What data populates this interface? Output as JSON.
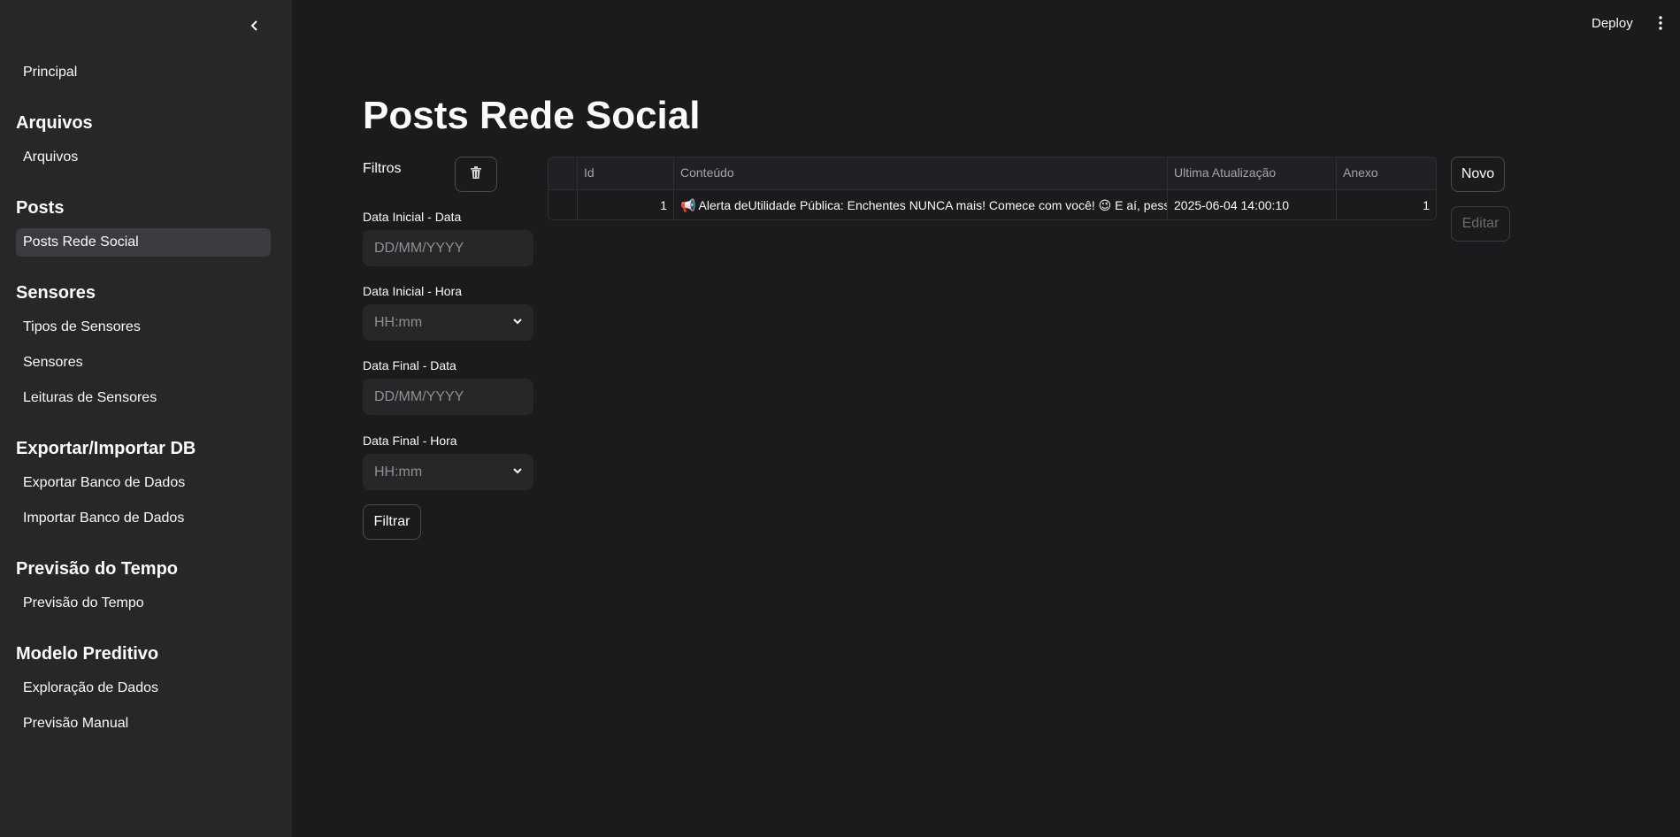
{
  "sidebar": {
    "collapse_icon": "chevron-left-icon",
    "items": [
      {
        "type": "link",
        "label": "Principal"
      },
      {
        "type": "section",
        "label": "Arquivos"
      },
      {
        "type": "link",
        "label": "Arquivos"
      },
      {
        "type": "section",
        "label": "Posts"
      },
      {
        "type": "link",
        "label": "Posts Rede Social",
        "active": true
      },
      {
        "type": "section",
        "label": "Sensores"
      },
      {
        "type": "link",
        "label": "Tipos de Sensores"
      },
      {
        "type": "link",
        "label": "Sensores"
      },
      {
        "type": "link",
        "label": "Leituras de Sensores"
      },
      {
        "type": "section",
        "label": "Exportar/Importar DB"
      },
      {
        "type": "link",
        "label": "Exportar Banco de Dados"
      },
      {
        "type": "link",
        "label": "Importar Banco de Dados"
      },
      {
        "type": "section",
        "label": "Previsão do Tempo"
      },
      {
        "type": "link",
        "label": "Previsão do Tempo"
      },
      {
        "type": "section",
        "label": "Modelo Preditivo"
      },
      {
        "type": "link",
        "label": "Exploração de Dados"
      },
      {
        "type": "link",
        "label": "Previsão Manual"
      }
    ]
  },
  "header": {
    "deploy_label": "Deploy",
    "menu_icon": "kebab-menu-icon"
  },
  "page": {
    "title": "Posts Rede Social"
  },
  "filters": {
    "label": "Filtros",
    "clear_icon": "trash-icon",
    "start_date_label": "Data Inicial - Data",
    "start_date_placeholder": "DD/MM/YYYY",
    "start_time_label": "Data Inicial - Hora",
    "start_time_placeholder": "HH:mm",
    "end_date_label": "Data Final - Data",
    "end_date_placeholder": "DD/MM/YYYY",
    "end_time_label": "Data Final - Hora",
    "end_time_placeholder": "HH:mm",
    "filter_button": "Filtrar"
  },
  "table": {
    "columns": [
      "",
      "Id",
      "Conteúdo",
      "Ultima Atualização",
      "Anexo"
    ],
    "rows": [
      {
        "index": "",
        "id": "1",
        "content": "📢 Alerta deUtilidade Pública: Enchentes NUNCA mais! Comece com você! 😉  E aí, pessoal! 📢",
        "updated": "2025-06-04 14:00:10",
        "attachment": "1"
      }
    ]
  },
  "actions": {
    "new_button": "Novo",
    "edit_button": "Editar"
  },
  "colors": {
    "background": "#1a1b1d",
    "sidebar": "#262729",
    "active_item": "#3b3c40",
    "input_bg": "#262729"
  }
}
